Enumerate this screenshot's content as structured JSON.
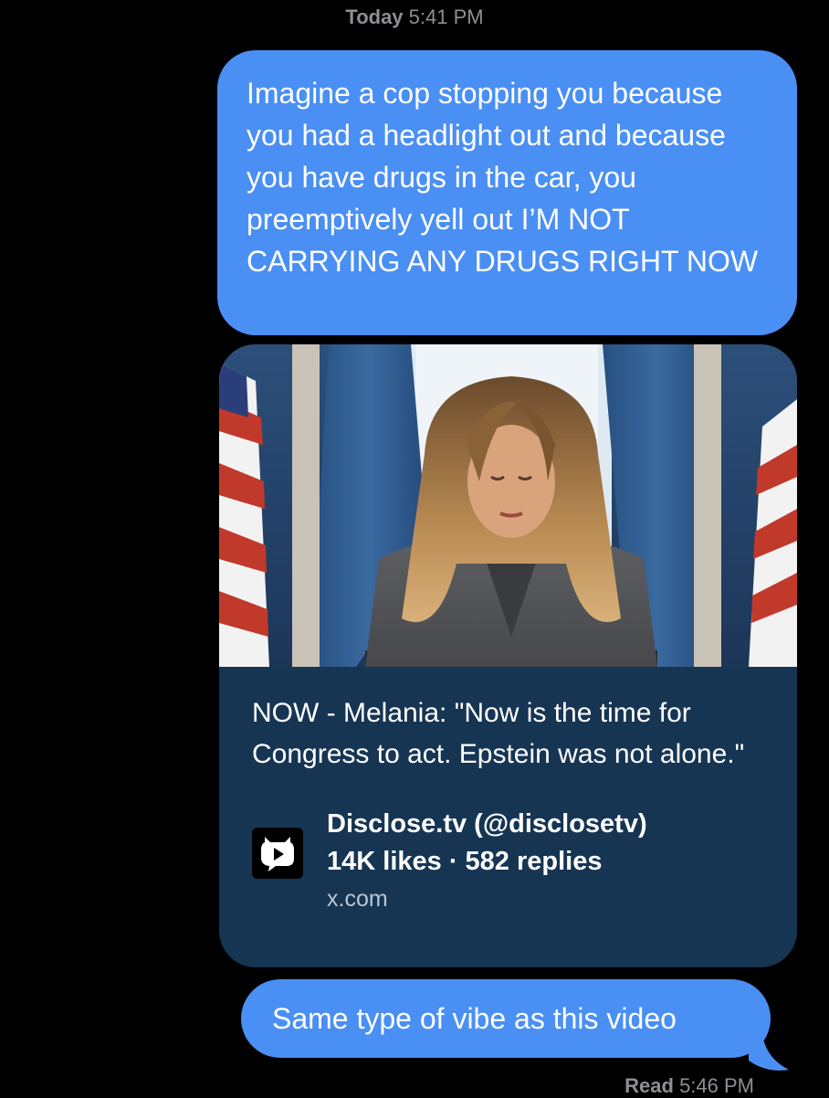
{
  "thread": {
    "timestamp_day": "Today",
    "timestamp_time": "5:41 PM"
  },
  "messages": [
    {
      "text": "Imagine a cop stopping you because you had a headlight out and because you have drugs in the car, you preemptively yell out I’M NOT CARRYING ANY DRUGS RIGHT NOW"
    },
    {
      "text": "Same type of vibe as this video"
    }
  ],
  "link_preview": {
    "title": "NOW - Melania: \"Now is the time for Congress to act. Epstein was not alone.\"",
    "source_name": "Disclose.tv (@disclosetv)",
    "stats": "14K likes · 582 replies",
    "domain": "x.com",
    "icon": "disclose-tv-logo-icon"
  },
  "read_receipt": {
    "label": "Read",
    "time": "5:46 PM"
  },
  "colors": {
    "bubble": "#4a8ff4",
    "card_background": "#163552",
    "background": "#000000",
    "meta_text": "#8e8e93"
  }
}
